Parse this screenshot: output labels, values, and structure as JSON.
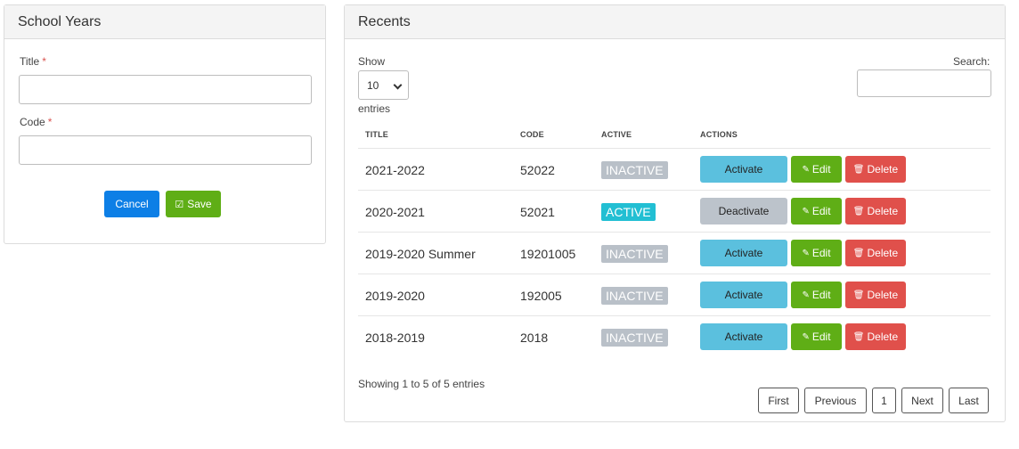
{
  "left_panel": {
    "title": "School Years",
    "title_label": "Title",
    "code_label": "Code",
    "required_mark": "*",
    "title_value": "",
    "code_value": "",
    "cancel_label": "Cancel",
    "save_label": "Save",
    "save_icon": "check-square-icon"
  },
  "right_panel": {
    "title": "Recents",
    "show_label": "Show",
    "entries_label": "entries",
    "page_size": "10",
    "search_label": "Search:",
    "search_value": "",
    "columns": [
      "TITLE",
      "CODE",
      "ACTIVE",
      "ACTIONS"
    ],
    "rows": [
      {
        "title": "2021-2022",
        "code": "52022",
        "status": "INACTIVE",
        "action": "Activate",
        "edit": "Edit",
        "delete": "Delete"
      },
      {
        "title": "2020-2021",
        "code": "52021",
        "status": "ACTIVE",
        "action": "Deactivate",
        "edit": "Edit",
        "delete": "Delete"
      },
      {
        "title": "2019-2020 Summer",
        "code": "19201005",
        "status": "INACTIVE",
        "action": "Activate",
        "edit": "Edit",
        "delete": "Delete"
      },
      {
        "title": "2019-2020",
        "code": "192005",
        "status": "INACTIVE",
        "action": "Activate",
        "edit": "Edit",
        "delete": "Delete"
      },
      {
        "title": "2018-2019",
        "code": "2018",
        "status": "INACTIVE",
        "action": "Activate",
        "edit": "Edit",
        "delete": "Delete"
      }
    ],
    "footer": "Showing 1 to 5 of 5 entries",
    "pagination": {
      "first": "First",
      "previous": "Previous",
      "page": "1",
      "next": "Next",
      "last": "Last"
    }
  },
  "colors": {
    "primary": "#0d7fe6",
    "success": "#5fae16",
    "danger": "#e0504b",
    "info": "#5bc0de",
    "active_badge": "#22bfd3",
    "inactive_badge": "#b9c0c8"
  }
}
